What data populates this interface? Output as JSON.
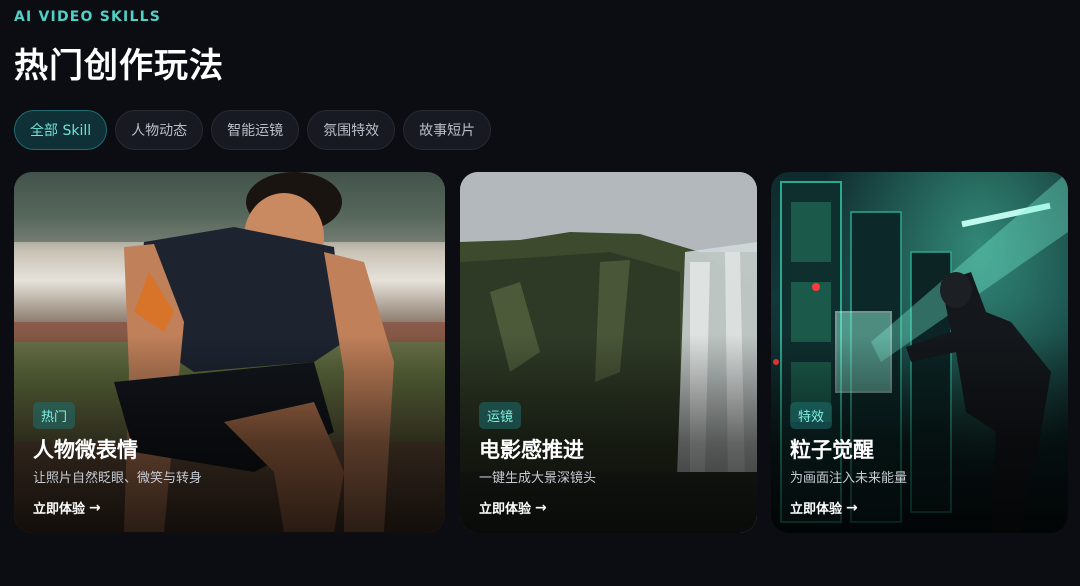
{
  "header": {
    "eyebrow": "AI VIDEO SKILLS",
    "title": "热门创作玩法"
  },
  "filters": [
    {
      "label": "全部 Skill",
      "active": true
    },
    {
      "label": "人物动态",
      "active": false
    },
    {
      "label": "智能运镜",
      "active": false
    },
    {
      "label": "氛围特效",
      "active": false
    },
    {
      "label": "故事短片",
      "active": false
    }
  ],
  "cards": [
    {
      "tag": "热门",
      "title": "人物微表情",
      "desc": "让照片自然眨眼、微笑与转身",
      "cta": "立即体验"
    },
    {
      "tag": "运镜",
      "title": "电影感推进",
      "desc": "一键生成大景深镜头",
      "cta": "立即体验"
    },
    {
      "tag": "特效",
      "title": "粒子觉醒",
      "desc": "为画面注入未来能量",
      "cta": "立即体验"
    }
  ],
  "colors": {
    "background": "#0b0d12",
    "accent": "#4fd1c5"
  }
}
